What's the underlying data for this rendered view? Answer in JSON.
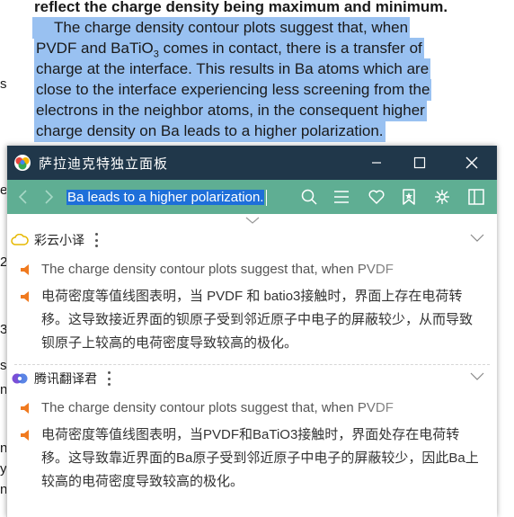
{
  "document": {
    "lines": [
      "reflect the charge density being maximum and minimum.",
      "The charge density contour plots suggest that, when",
      "PVDF and BaTiO",
      "comes in contact, there is a transfer of",
      "charge at the interface. This results in Ba atoms which are",
      "close to the interface experiencing less screening from the",
      "electrons in the neighbor atoms, in the consequent higher",
      "charge density on Ba leads to a higher polarization."
    ],
    "subscript": "3",
    "margin_fragments": [
      "s",
      "e",
      "2)",
      "3)",
      "s",
      "n-",
      "n",
      "y",
      "n-"
    ]
  },
  "panel": {
    "title": "萨拉迪克特独立面板",
    "query": "Ba leads to a higher polarization.",
    "dictionaries": [
      {
        "name": "彩云小译",
        "icon": "cloud-icon",
        "source": "The charge density contour plots suggest that, when PVDF",
        "translation": "电荷密度等值线图表明，当 PVDF 和 batio3接触时，界面上存在电荷转移。这导致接近界面的钡原子受到邻近原子中电子的屏蔽较少，从而导致钡原子上较高的电荷密度导致较高的极化。"
      },
      {
        "name": "腾讯翻译君",
        "icon": "tencent-icon",
        "source": "The charge density contour plots suggest that, when PVDF",
        "translation": "电荷密度等值线图表明，当PVDF和BaTiO3接触时，界面处存在电荷转移。这导致靠近界面的Ba原子受到邻近原子中电子的屏蔽较少，因此Ba上较高的电荷密度导致较高的极化。"
      }
    ]
  },
  "colors": {
    "titlebar": "#20374a",
    "toolbar": "#5fae93",
    "selection": "#99c1f1",
    "speaker": "#f07a1f"
  }
}
